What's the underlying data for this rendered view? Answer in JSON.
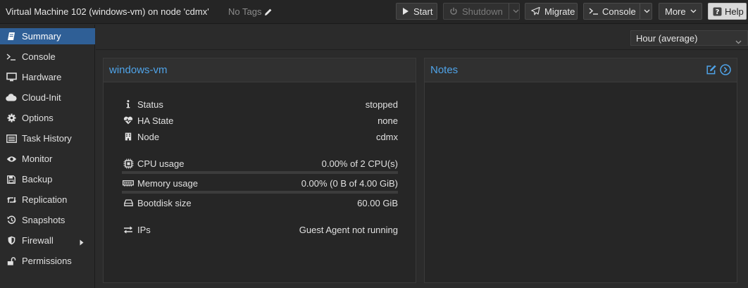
{
  "header": {
    "title": "Virtual Machine 102 (windows-vm) on node 'cdmx'",
    "tags_label": "No Tags",
    "buttons": {
      "start": "Start",
      "shutdown": "Shutdown",
      "migrate": "Migrate",
      "console": "Console",
      "more": "More",
      "help": "Help"
    }
  },
  "sidebar": {
    "items": [
      {
        "label": "Summary",
        "icon": "book-icon",
        "active": true
      },
      {
        "label": "Console",
        "icon": "terminal-icon"
      },
      {
        "label": "Hardware",
        "icon": "monitor-icon"
      },
      {
        "label": "Cloud-Init",
        "icon": "cloud-icon"
      },
      {
        "label": "Options",
        "icon": "gear-icon"
      },
      {
        "label": "Task History",
        "icon": "list-icon"
      },
      {
        "label": "Monitor",
        "icon": "eye-icon"
      },
      {
        "label": "Backup",
        "icon": "floppy-icon"
      },
      {
        "label": "Replication",
        "icon": "retweet-icon"
      },
      {
        "label": "Snapshots",
        "icon": "history-icon"
      },
      {
        "label": "Firewall",
        "icon": "shield-icon"
      },
      {
        "label": "Permissions",
        "icon": "unlock-icon"
      }
    ]
  },
  "toolbar": {
    "timeframe": "Hour (average)"
  },
  "summary": {
    "title": "windows-vm",
    "status": {
      "label": "Status",
      "value": "stopped"
    },
    "ha_state": {
      "label": "HA State",
      "value": "none"
    },
    "node": {
      "label": "Node",
      "value": "cdmx"
    },
    "cpu": {
      "label": "CPU usage",
      "value": "0.00% of 2 CPU(s)",
      "fraction": 0
    },
    "memory": {
      "label": "Memory usage",
      "value": "0.00% (0 B of 4.00 GiB)",
      "fraction": 0
    },
    "bootdisk": {
      "label": "Bootdisk size",
      "value": "60.00 GiB"
    },
    "ips": {
      "label": "IPs",
      "value": "Guest Agent not running"
    }
  },
  "notes": {
    "title": "Notes"
  },
  "colors": {
    "accent": "#4fa3e8",
    "active_nav": "#2f5f96",
    "background": "#2b2b2b"
  }
}
